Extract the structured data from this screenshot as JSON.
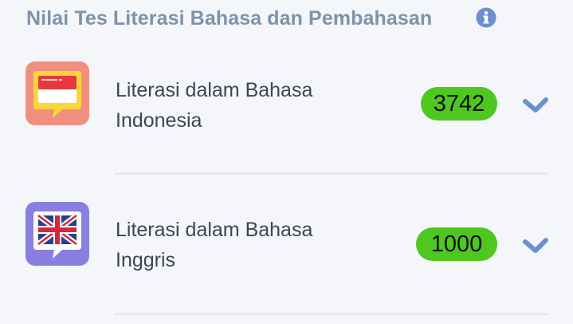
{
  "header": {
    "title": "Nilai Tes Literasi Bahasa dan Pembahasan",
    "info_icon": "info-icon"
  },
  "items": [
    {
      "title_line1": "Literasi dalam Bahasa",
      "title_line2": "Indonesia",
      "score": "3742",
      "badge_icon": "indonesia-flag-speech-bubble-icon",
      "badge_color": "#f08f7f",
      "expand_icon": "chevron-down-icon"
    },
    {
      "title_line1": "Literasi dalam Bahasa",
      "title_line2": "Inggris",
      "score": "1000",
      "badge_icon": "uk-flag-speech-bubble-icon",
      "badge_color": "#8a7fe0",
      "expand_icon": "chevron-down-icon"
    }
  ],
  "colors": {
    "score_badge": "#4fc721",
    "header_text": "#7e92ab",
    "accent": "#6d8fd1"
  }
}
